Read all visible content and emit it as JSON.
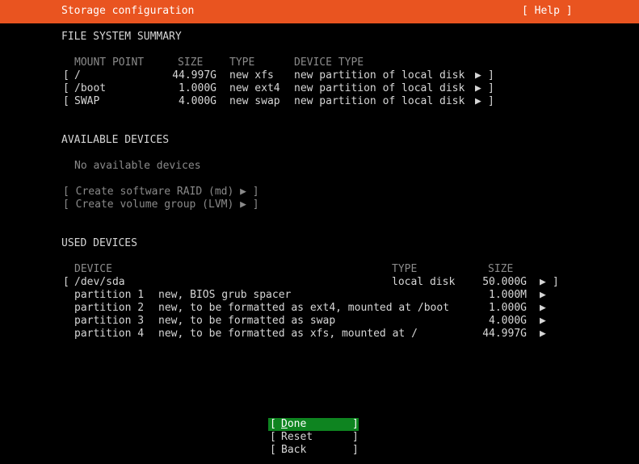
{
  "header": {
    "title": "Storage configuration",
    "help": "[ Help ]"
  },
  "fs_summary": {
    "heading": "FILE SYSTEM SUMMARY",
    "columns": {
      "mount": "MOUNT POINT",
      "size": "SIZE",
      "type": "TYPE",
      "device_type": "DEVICE TYPE"
    },
    "rows": [
      {
        "open": "[",
        "mount": "/",
        "size": "44.997G",
        "type": "new xfs",
        "device_type": "new partition of local disk",
        "arrow": "▶",
        "close": "]"
      },
      {
        "open": "[",
        "mount": "/boot",
        "size": "1.000G",
        "type": "new ext4",
        "device_type": "new partition of local disk",
        "arrow": "▶",
        "close": "]"
      },
      {
        "open": "[",
        "mount": "SWAP",
        "size": "4.000G",
        "type": "new swap",
        "device_type": "new partition of local disk",
        "arrow": "▶",
        "close": "]"
      }
    ]
  },
  "available": {
    "heading": "AVAILABLE DEVICES",
    "empty_text": "No available devices",
    "create_raid": "[ Create software RAID (md) ▶ ]",
    "create_lvm": "[ Create volume group (LVM) ▶ ]"
  },
  "used": {
    "heading": "USED DEVICES",
    "columns": {
      "device": "DEVICE",
      "type": "TYPE",
      "size": "SIZE"
    },
    "disk": {
      "open": "[",
      "device": "/dev/sda",
      "type": "local disk",
      "size": "50.000G",
      "arrow": "▶",
      "close": "]"
    },
    "partitions": [
      {
        "name": "partition 1",
        "desc": "new, BIOS grub spacer",
        "size": "1.000M",
        "arrow": "▶"
      },
      {
        "name": "partition 2",
        "desc": "new, to be formatted as ext4, mounted at /boot",
        "size": "1.000G",
        "arrow": "▶"
      },
      {
        "name": "partition 3",
        "desc": "new, to be formatted as swap",
        "size": "4.000G",
        "arrow": "▶"
      },
      {
        "name": "partition 4",
        "desc": "new, to be formatted as xfs, mounted at /",
        "size": "44.997G",
        "arrow": "▶"
      }
    ]
  },
  "buttons": {
    "open": "[",
    "close": "]",
    "done_first": "D",
    "done_rest": "one",
    "reset": "Reset",
    "back": "Back"
  },
  "colors": {
    "header": "#e95420",
    "done_button": "#0e8420",
    "text": "#d6d6d6",
    "dim": "#8a8a8a"
  }
}
